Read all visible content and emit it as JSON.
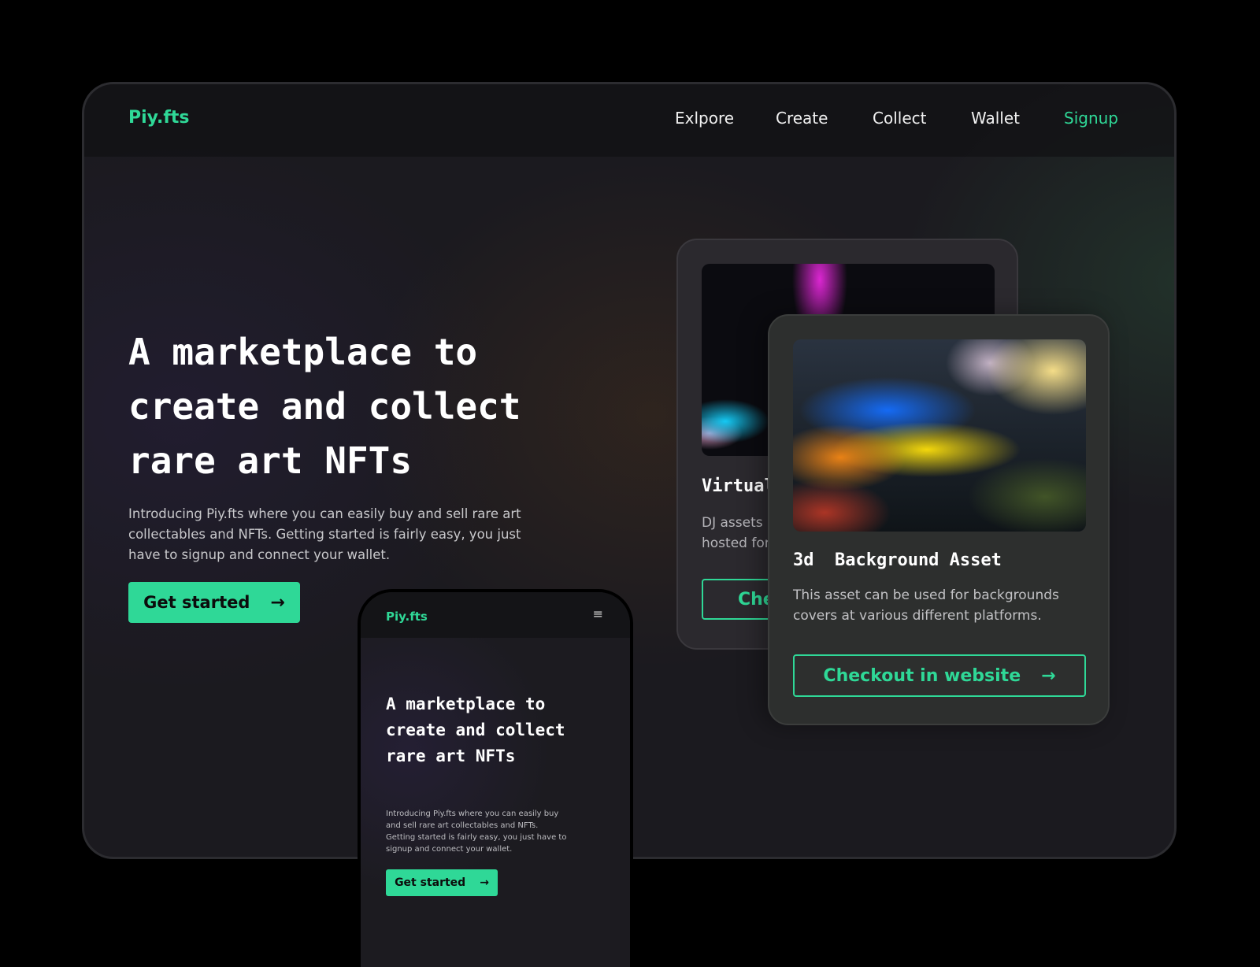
{
  "nav": {
    "logo": "Piy.fts",
    "items": [
      "Exlpore",
      "Create",
      "Collect",
      "Wallet"
    ],
    "signup": "Signup"
  },
  "hero": {
    "title": "A marketplace to create and collect rare art NFTs",
    "description": "Introducing Piy.fts where you can easily buy and sell rare art collectables and NFTs. Getting started is fairly easy, you just have to signup and connect your wallet.",
    "cta": "Get started",
    "cta_icon": "→"
  },
  "cards": {
    "back": {
      "title": "Virtual",
      "desc_line1": "DJ assets",
      "desc_line2": "hosted for",
      "button": "Che"
    },
    "front": {
      "title": "3d  Background Asset",
      "description": "This asset can be used for backgrounds covers at various different platforms.",
      "button": "Checkout in website",
      "button_icon": "→"
    }
  },
  "phone": {
    "logo": "Piy.fts",
    "menu_icon": "≡",
    "title": "A marketplace to create and collect rare art NFTs",
    "description": "Introducing Piy.fts where you can easily buy and sell rare art collectables and NFTs. Getting started is fairly easy, you just have to signup and connect your wallet.",
    "cta": "Get started",
    "cta_icon": "→"
  },
  "colors": {
    "accent": "#2fd897",
    "background": "#1b1a1f",
    "frame": "#000000"
  }
}
